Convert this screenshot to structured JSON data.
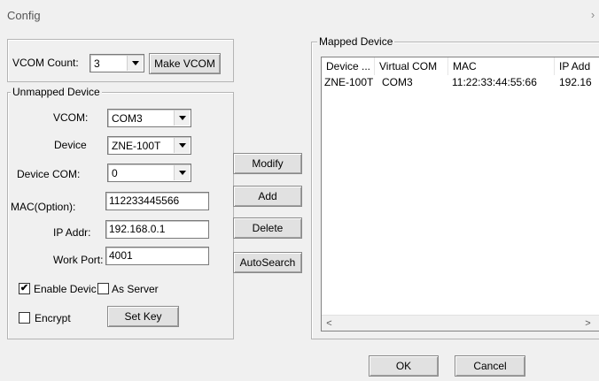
{
  "window": {
    "title": "Config",
    "close_glyph": "›"
  },
  "vcom": {
    "count_label": "VCOM Count:",
    "count_value": "3",
    "make_button": "Make VCOM"
  },
  "unmapped": {
    "legend": "Unmapped Device",
    "vcom_label": "VCOM:",
    "vcom_value": "COM3",
    "device_label": "Device",
    "device_value": "ZNE-100T",
    "device_com_label": "Device COM:",
    "device_com_value": "0",
    "mac_label": "MAC(Option):",
    "mac_value": "112233445566",
    "ip_label": "IP Addr:",
    "ip_value": "192.168.0.1",
    "port_label": "Work Port:",
    "port_value": "4001",
    "enable_label": "Enable Devic",
    "enable_checked": "✔",
    "server_label": "As Server",
    "encrypt_label": "Encrypt",
    "setkey_button": "Set Key"
  },
  "actions": {
    "modify": "Modify",
    "add": "Add",
    "delete": "Delete",
    "autosearch": "AutoSearch"
  },
  "mapped": {
    "legend": "Mapped Device",
    "columns": [
      "Device ...",
      "Virtual COM",
      "MAC",
      "IP Add"
    ],
    "rows": [
      [
        "ZNE-100T",
        "COM3",
        "11:22:33:44:55:66",
        "192.16"
      ]
    ]
  },
  "dialog": {
    "ok": "OK",
    "cancel": "Cancel"
  }
}
